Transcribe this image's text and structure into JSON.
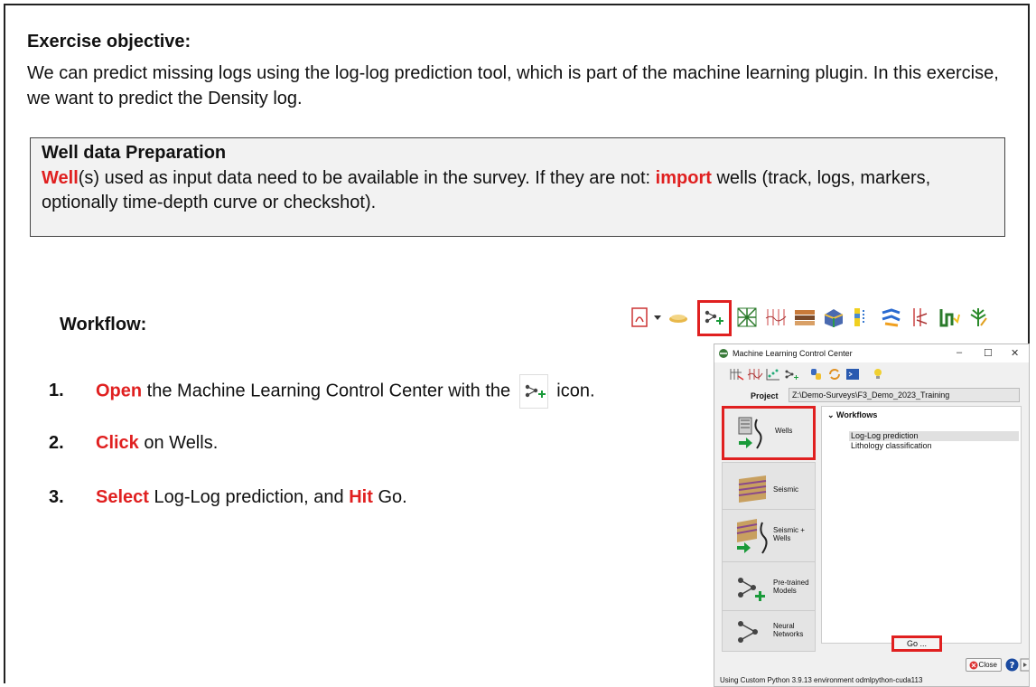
{
  "objective": {
    "title": "Exercise objective:",
    "text": "We can predict missing logs using the log-log prediction tool, which is part of the machine learning plugin. In this exercise, we want to predict the Density log."
  },
  "preparation": {
    "title": "Well data Preparation",
    "word_well": "Well",
    "text_1": "(s) used as input data need to be available in the survey. If they are not: ",
    "word_import": "import",
    "text_2": " wells (track, logs, markers, optionally time-depth curve or checkshot)."
  },
  "workflow": {
    "title": "Workflow:",
    "steps": [
      {
        "num": "1.",
        "key": "Open",
        "text_a": " the Machine Learning Control Center with the ",
        "text_b": " icon."
      },
      {
        "num": "2.",
        "key": "Click",
        "text_a": " on Wells."
      },
      {
        "num": "3.",
        "key": "Select",
        "text_a": " Log-Log prediction, and ",
        "key2": "Hit",
        "text_b": " Go."
      }
    ]
  },
  "window": {
    "title": "Machine Learning Control Center",
    "project_label": "Project",
    "project_value": "Z:\\Demo-Surveys\\F3_Demo_2023_Training",
    "workflows_header": "Workflows",
    "workflow_items": [
      "Log-Log prediction",
      "Lithology classification"
    ],
    "side_buttons": [
      {
        "label": "Wells"
      },
      {
        "label": "Seismic"
      },
      {
        "label": "Seismic +\nWells"
      },
      {
        "label": "Pre-trained\nModels"
      },
      {
        "label": "Neural\nNetworks"
      }
    ],
    "go_label": "Go ...",
    "close_label": "Close",
    "status_text": "Using Custom Python 3.9.13 environment odmlpython-cuda113"
  },
  "colors": {
    "highlight_red": "#e02020"
  }
}
